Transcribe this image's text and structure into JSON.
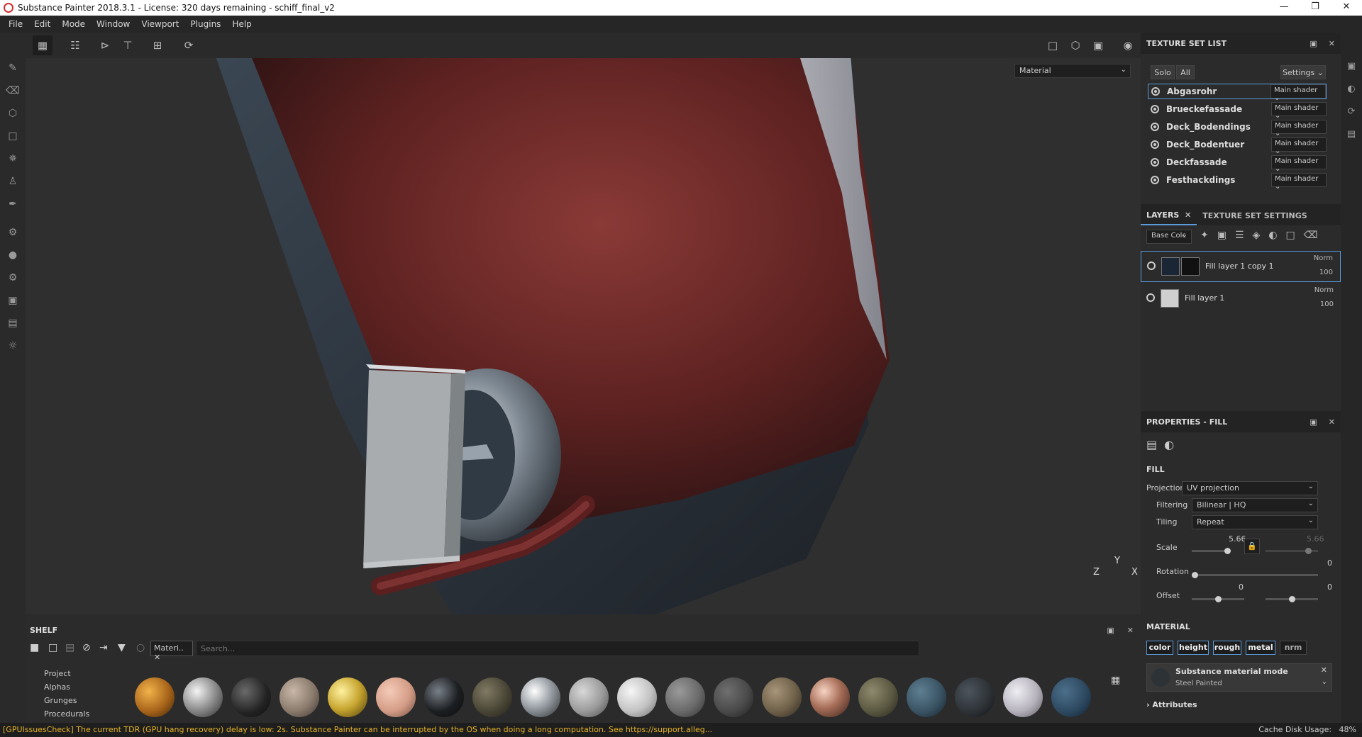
{
  "window": {
    "title": "Substance Painter 2018.3.1 - License: 320 days remaining - schiff_final_v2"
  },
  "menu": [
    "File",
    "Edit",
    "Mode",
    "Window",
    "Viewport",
    "Plugins",
    "Help"
  ],
  "viewport": {
    "mode_select": "Material",
    "axis": {
      "z": "Z",
      "y": "Y",
      "x": "X"
    }
  },
  "texture_set_list": {
    "title": "TEXTURE SET LIST",
    "solo": "Solo",
    "all": "All",
    "settings": "Settings",
    "items": [
      {
        "name": "Abgasrohr",
        "shader": "Main shader"
      },
      {
        "name": "Brueckefassade",
        "shader": "Main shader"
      },
      {
        "name": "Deck_Bodendings",
        "shader": "Main shader"
      },
      {
        "name": "Deck_Bodentuer",
        "shader": "Main shader"
      },
      {
        "name": "Deckfassade",
        "shader": "Main shader"
      },
      {
        "name": "Festhackdings",
        "shader": "Main shader"
      }
    ]
  },
  "layers": {
    "tab_layers": "LAYERS",
    "tab_tss": "TEXTURE SET SETTINGS",
    "channel": "Base Colc",
    "items": [
      {
        "name": "Fill layer 1 copy 1",
        "blend": "Norm",
        "opacity": "100"
      },
      {
        "name": "Fill layer 1",
        "blend": "Norm",
        "opacity": "100"
      }
    ]
  },
  "properties": {
    "title": "PROPERTIES - FILL",
    "fill_label": "FILL",
    "projection_label": "Projection",
    "projection": "UV projection",
    "filtering_label": "Filtering",
    "filtering": "Bilinear | HQ",
    "tiling_label": "Tiling",
    "tiling": "Repeat",
    "scale_label": "Scale",
    "scale_u": "5.66",
    "scale_v": "5.66",
    "rotation_label": "Rotation",
    "rotation": "0",
    "offset_label": "Offset",
    "offset_u": "0",
    "offset_v": "0",
    "material_label": "MATERIAL",
    "channels": [
      "color",
      "height",
      "rough",
      "metal",
      "nrm"
    ],
    "mode_title": "Substance material mode",
    "mode_value": "Steel Painted",
    "attributes": "Attributes"
  },
  "shelf": {
    "title": "SHELF",
    "filter_chip": "Materi..",
    "search_placeholder": "Search...",
    "categories": [
      "Project",
      "Alphas",
      "Grunges",
      "Procedurals"
    ]
  },
  "status": {
    "warning": "[GPUIssuesCheck] The current TDR (GPU hang recovery) delay is low: 2s. Substance Painter can be interrupted by the OS when doing a long computation. See https://support.alleg...",
    "cache_label": "Cache Disk Usage:",
    "cache_value": "48%"
  },
  "colors": {
    "accent": "#5a9ad9",
    "warning": "#e6b325"
  }
}
